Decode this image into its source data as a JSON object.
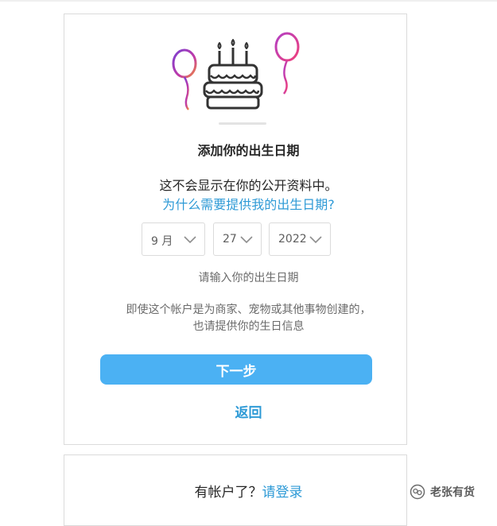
{
  "dialog": {
    "title": "添加你的出生日期",
    "subtitle": "这不会显示在你的公开资料中。",
    "why_link": "为什么需要提供我的出生日期?",
    "birthday": {
      "month": "9 月",
      "day": "27",
      "year": "2022"
    },
    "hint": "请输入你的出生日期",
    "note_line1": "即使这个帐户是为商家、宠物或其他事物创建的，",
    "note_line2": "也请提供你的生日信息",
    "next_button": "下一步",
    "back_link": "返回"
  },
  "login": {
    "prompt": "有帐户了？",
    "link": "请登录"
  },
  "watermark": {
    "text": "老张有货"
  },
  "colors": {
    "link": "#2e9ad6",
    "button": "#4bb1f3",
    "border": "#dbdbdb"
  },
  "icons": {
    "illustration": "birthday-cake-with-balloons",
    "dropdown": "chevron-down-icon",
    "watermark": "wechat-official-account-icon"
  }
}
